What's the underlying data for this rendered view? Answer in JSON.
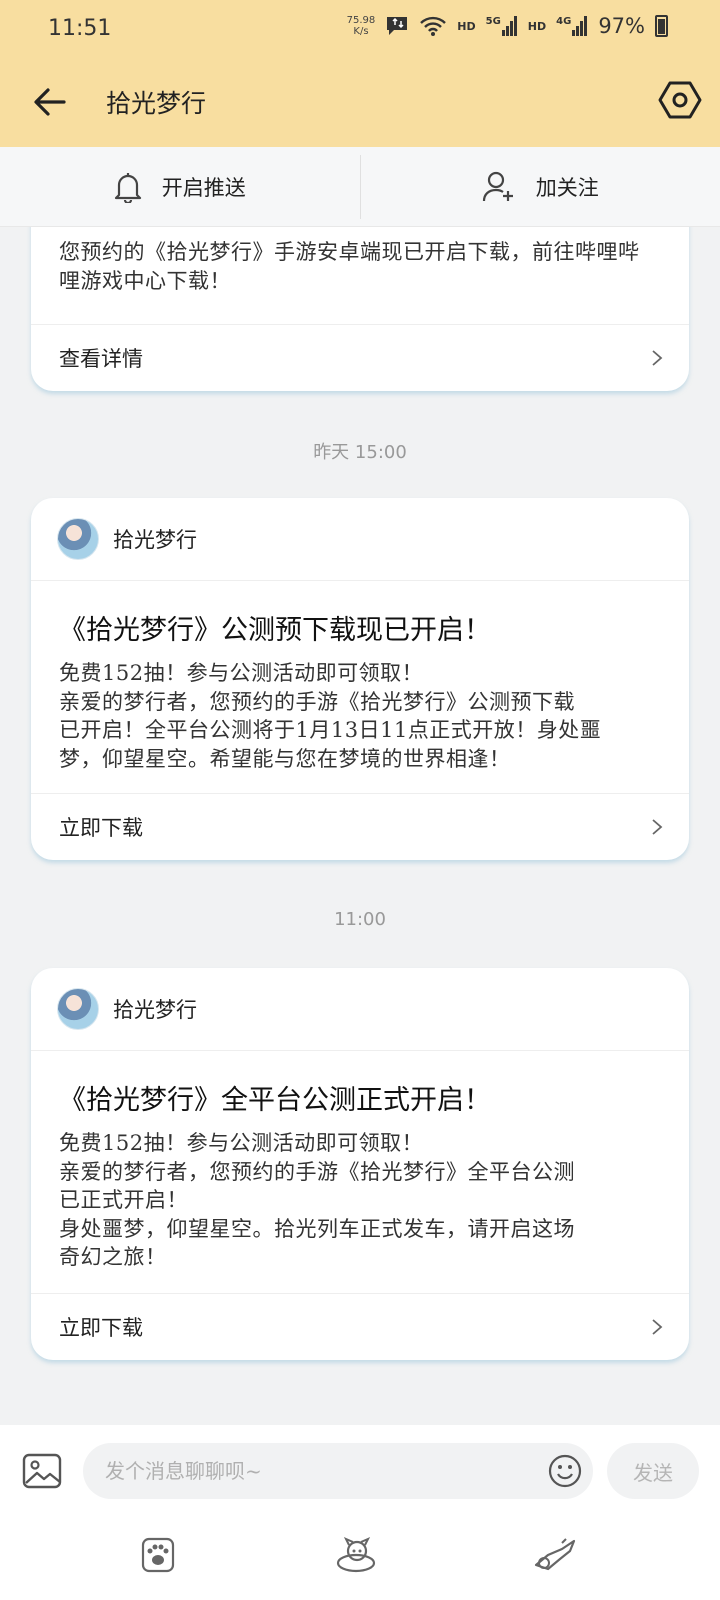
{
  "status_bar": {
    "time": "11:51",
    "net_speed_value": "75.98",
    "net_speed_unit": "K/s",
    "hd1": "HD",
    "net1": "5G",
    "hd2": "HD",
    "net2": "4G",
    "battery": "97%"
  },
  "nav": {
    "title": "拾光梦行",
    "back_icon": "arrow-left-icon",
    "settings_icon": "hexagon-settings-icon"
  },
  "actions": {
    "push_label": "开启推送",
    "follow_label": "加关注"
  },
  "messages": [
    {
      "text": "您预约的《拾光梦行》手游安卓端现已开启下载，前往哔哩哔哩游戏中心下载！",
      "link": "查看详情"
    },
    {
      "time": "昨天 15:00",
      "sender": "拾光梦行",
      "title": "《拾光梦行》公测预下载现已开启！",
      "lines": [
        "免费152抽！参与公测活动即可领取！",
        "亲爱的梦行者，您预约的手游《拾光梦行》公测预下载",
        "已开启！全平台公测将于1月13日11点正式开放！身处噩",
        "梦，仰望星空。希望能与您在梦境的世界相逢！"
      ],
      "link": "立即下载"
    },
    {
      "time": "11:00",
      "sender": "拾光梦行",
      "title": "《拾光梦行》全平台公测正式开启！",
      "lines": [
        "免费152抽！参与公测活动即可领取！",
        "亲爱的梦行者，您预约的手游《拾光梦行》全平台公测",
        "已正式开启！",
        "身处噩梦，仰望星空。拾光列车正式发车，请开启这场",
        "奇幻之旅！"
      ],
      "link": "立即下载"
    }
  ],
  "composer": {
    "placeholder": "发个消息聊聊呗~",
    "send_label": "发送"
  }
}
